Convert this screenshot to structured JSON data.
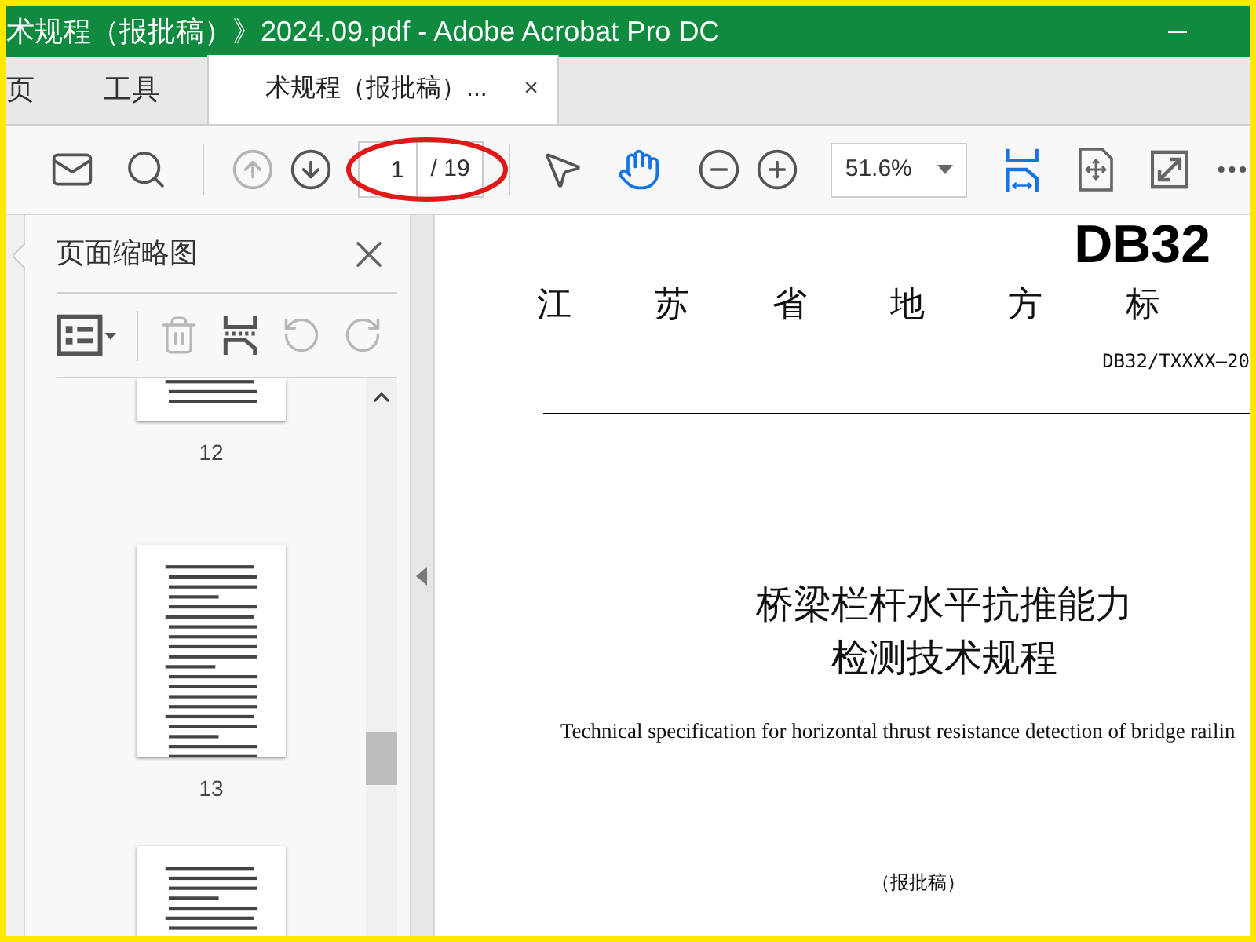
{
  "window": {
    "title": "术规程（报批稿）》2024.09.pdf - Adobe Acrobat Pro DC"
  },
  "menu_tabs": [
    {
      "label": "页",
      "selected": false
    },
    {
      "label": "工具",
      "selected": false
    }
  ],
  "document_tab": {
    "label": "术规程（报批稿）...",
    "close": "×",
    "selected": true
  },
  "toolbar": {
    "share_buttons": [
      {
        "kind": "mail"
      },
      {
        "kind": "search"
      }
    ],
    "nav_buttons": [
      {
        "kind": "previous_page",
        "disabled": true
      },
      {
        "kind": "next_page",
        "disabled": false
      }
    ],
    "page_input": {
      "value": "1"
    },
    "page_total": "/ 19",
    "tools": [
      {
        "kind": "select",
        "selected": false
      },
      {
        "kind": "hand",
        "selected": true
      }
    ],
    "zoom_buttons": [
      {
        "kind": "zoom_out"
      },
      {
        "kind": "zoom_in"
      }
    ],
    "zoom_level": {
      "value": "51.6%"
    },
    "view_buttons": [
      {
        "kind": "fit_width",
        "selected": true
      },
      {
        "kind": "fit_page",
        "selected": false
      },
      {
        "kind": "full_screen",
        "selected": false
      }
    ]
  },
  "sidebar": {
    "title": "页面缩略图",
    "tools": [
      {
        "kind": "options",
        "disabled": false
      },
      {
        "kind": "delete",
        "disabled": true
      },
      {
        "kind": "insert",
        "disabled": false
      },
      {
        "kind": "rotate_left",
        "disabled": true
      },
      {
        "kind": "rotate_right",
        "disabled": true
      }
    ],
    "thumbnails": [
      {
        "kind": "cut_top",
        "label": "12"
      },
      {
        "kind": "full",
        "label": "13"
      },
      {
        "kind": "cut_bottom"
      }
    ]
  },
  "document": {
    "code_mark": "DB32",
    "heading": "江 苏 省 地 方 标",
    "number": "DB32/TXXXX—20",
    "title_lines": [
      "桥梁栏杆水平抗推能力",
      "检测技术规程"
    ],
    "english_title": "Technical specification for horizontal thrust resistance detection of bridge railin",
    "status": "（报批稿）"
  }
}
